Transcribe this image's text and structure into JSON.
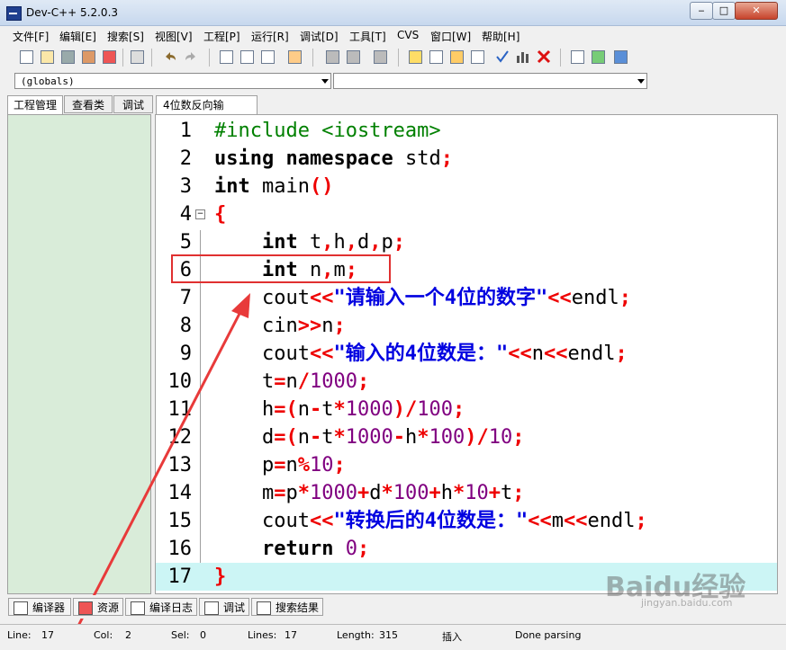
{
  "window": {
    "title": "Dev-C++ 5.2.0.3"
  },
  "menu": [
    "文件[F]",
    "编辑[E]",
    "搜索[S]",
    "视图[V]",
    "工程[P]",
    "运行[R]",
    "调试[D]",
    "工具[T]",
    "CVS",
    "窗口[W]",
    "帮助[H]"
  ],
  "combo": {
    "scope": "(globals)",
    "symbol": ""
  },
  "left_tabs": [
    "工程管理",
    "查看类",
    "调试"
  ],
  "editor_tab": "4位数反向输出.cpp",
  "code": [
    {
      "n": "1",
      "text": "#include <iostream>"
    },
    {
      "n": "2",
      "text": "using namespace std;"
    },
    {
      "n": "3",
      "text": "int main()"
    },
    {
      "n": "4",
      "text": "{"
    },
    {
      "n": "5",
      "text": "    int t,h,d,p;"
    },
    {
      "n": "6",
      "text": "    int n,m;"
    },
    {
      "n": "7",
      "text": "    cout<<\"请输入一个4位的数字\"<<endl;"
    },
    {
      "n": "8",
      "text": "    cin>>n;"
    },
    {
      "n": "9",
      "text": "    cout<<\"输入的4位数是：\"<<n<<endl;"
    },
    {
      "n": "10",
      "text": "    t=n/1000;"
    },
    {
      "n": "11",
      "text": "    h=(n-t*1000)/100;"
    },
    {
      "n": "12",
      "text": "    d=(n-t*1000-h*100)/10;"
    },
    {
      "n": "13",
      "text": "    p=n%10;"
    },
    {
      "n": "14",
      "text": "    m=p*1000+d*100+h*10+t;"
    },
    {
      "n": "15",
      "text": "    cout<<\"转换后的4位数是：\"<<m<<endl;"
    },
    {
      "n": "16",
      "text": "    return 0;"
    },
    {
      "n": "17",
      "text": "}"
    }
  ],
  "bottom_tabs": [
    "编译器",
    "资源",
    "编译日志",
    "调试",
    "搜索结果"
  ],
  "status": {
    "line_label": "Line:",
    "line": "17",
    "col_label": "Col:",
    "col": "2",
    "sel_label": "Sel:",
    "sel": "0",
    "lines_label": "Lines:",
    "lines": "17",
    "length_label": "Length:",
    "length": "315",
    "mode": "插入",
    "message": "Done parsing"
  },
  "watermark": {
    "brand": "Baidu经验",
    "url": "jingyan.baidu.com"
  }
}
